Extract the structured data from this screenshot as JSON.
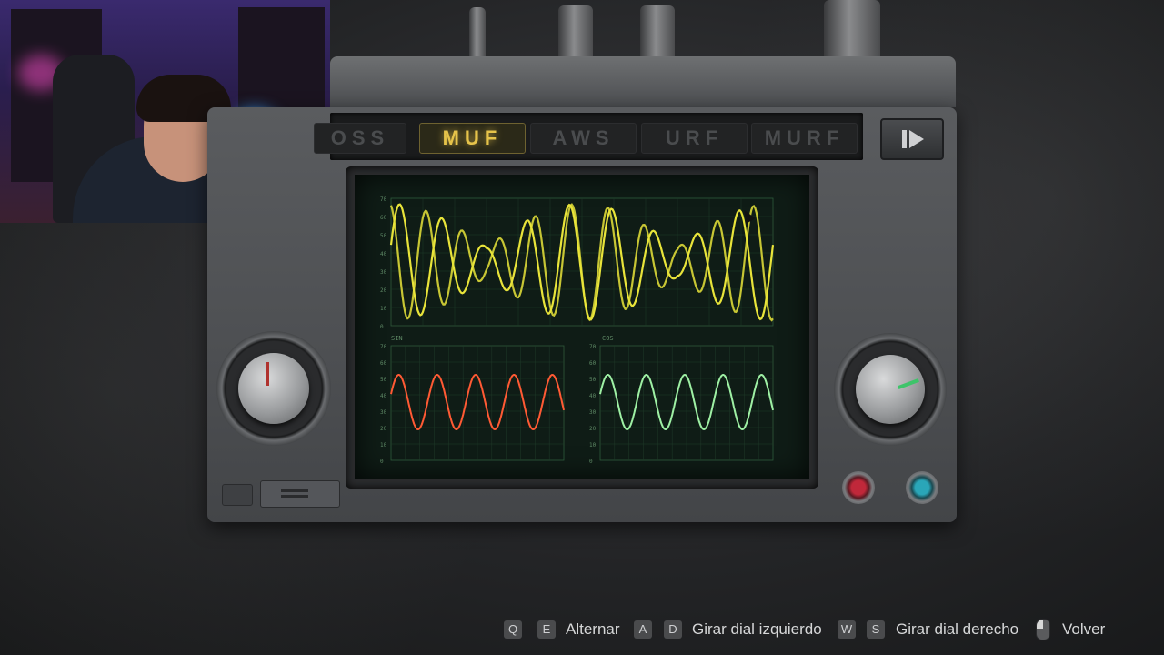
{
  "tabs": [
    {
      "label": "OSS",
      "active": false
    },
    {
      "label": "MUF",
      "active": true
    },
    {
      "label": "AWS",
      "active": false
    },
    {
      "label": "URF",
      "active": false
    },
    {
      "label": "MURF",
      "active": false
    }
  ],
  "main_scope": {
    "ticks": [
      "70",
      "60",
      "50",
      "40",
      "30",
      "20",
      "10",
      "0"
    ],
    "trace_color": "#e8e43a"
  },
  "sin_scope": {
    "label": "SIN",
    "ticks": [
      "70",
      "60",
      "50",
      "40",
      "30",
      "20",
      "10",
      "0"
    ],
    "trace_color": "#ff5a34"
  },
  "cos_scope": {
    "label": "COS",
    "ticks": [
      "70",
      "60",
      "50",
      "40",
      "30",
      "20",
      "10",
      "0"
    ],
    "trace_color": "#9ef0a4"
  },
  "hints": [
    {
      "keys": [
        "Q",
        "E"
      ],
      "label": "Alternar"
    },
    {
      "keys": [
        "A",
        "D"
      ],
      "label": "Girar dial izquierdo"
    },
    {
      "keys": [
        "W",
        "S"
      ],
      "label": "Girar dial derecho"
    },
    {
      "keys": [
        "mouse-right-icon"
      ],
      "label": "Volver"
    }
  ],
  "colors": {
    "active_tab": "#e6c34a",
    "left_knob_marker": "#b0322e",
    "right_knob_marker": "#3ec46a",
    "red_button": "#c0283a",
    "teal_button": "#2aa6b8"
  }
}
